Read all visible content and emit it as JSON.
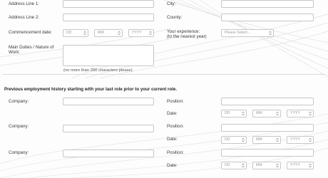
{
  "address": {
    "line1_label": "Address Line 1:",
    "line2_label": "Address Line 2:",
    "city_label": "City:",
    "county_label": "County:"
  },
  "commencement": {
    "label": "Commencement date:",
    "day": "DD",
    "month": "MM",
    "year": "YYYY"
  },
  "experience": {
    "label_line1": "Your experience:",
    "label_line2": "(to the nearest year)",
    "select_placeholder": "Please Select..."
  },
  "duties": {
    "label": "Main Duties / Nature of Work:",
    "hint": "(no more than 200 characters please)"
  },
  "history": {
    "title": "Previous employment history starting with your last role prior to your current role.",
    "company_label": "Company:",
    "position_label": "Position:",
    "date_label": "Date:",
    "day": "DD",
    "month": "MM",
    "year": "YYYY"
  }
}
